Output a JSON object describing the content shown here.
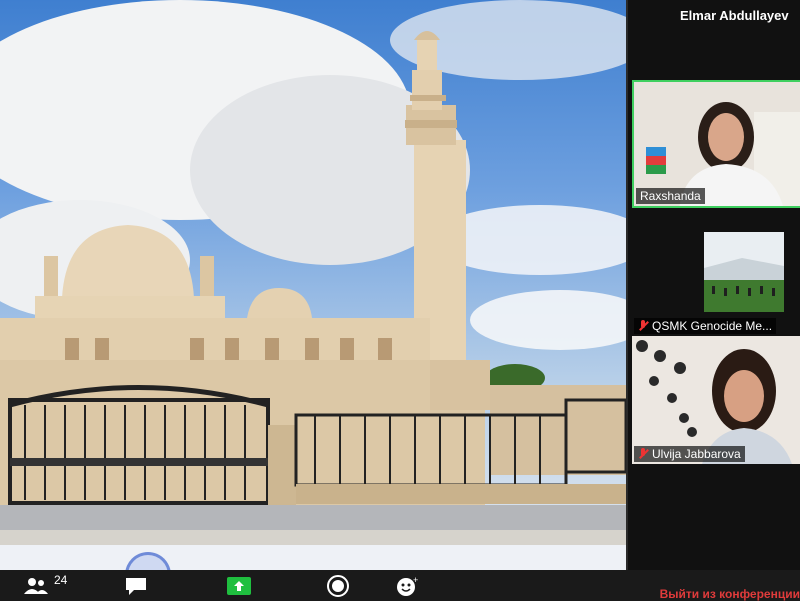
{
  "shared_screen": {
    "description_icon": "mosque-photo"
  },
  "panel": {
    "active_speaker": "Elmar Abdullayev",
    "participants": [
      {
        "name": "Raxshanda",
        "muted": false
      },
      {
        "name": "QSMK Genocide Me...",
        "muted": true
      },
      {
        "name": "Ulvija Jabbarova",
        "muted": true
      }
    ]
  },
  "toolbar": {
    "participants_count": "24",
    "leave_label": "Выйти из конференции",
    "icons": [
      "participants-icon",
      "chat-icon",
      "share-screen-icon",
      "record-icon",
      "reactions-icon"
    ],
    "accent_green": "#1fbf3f",
    "leave_color": "#e03b3b"
  },
  "colors": {
    "active_border": "#3fcf5f"
  }
}
